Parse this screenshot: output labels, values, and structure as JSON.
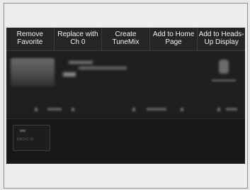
{
  "menu": {
    "items": [
      {
        "line1": "Remove",
        "line2": "Favorite"
      },
      {
        "line1": "Replace with",
        "line2": "Ch 0"
      },
      {
        "line1": "Create",
        "line2": "TuneMix"
      },
      {
        "line1": "Add to Home",
        "line2": "Page"
      },
      {
        "line1": "Add to Heads-",
        "line2": "Up Display"
      }
    ]
  },
  "lower": {
    "radio_id_label": "RADIO ID"
  },
  "colors": {
    "screen_bg": "#1b1b1b",
    "menu_text": "#f2f2f2",
    "frame_border": "#8f8f8f"
  }
}
